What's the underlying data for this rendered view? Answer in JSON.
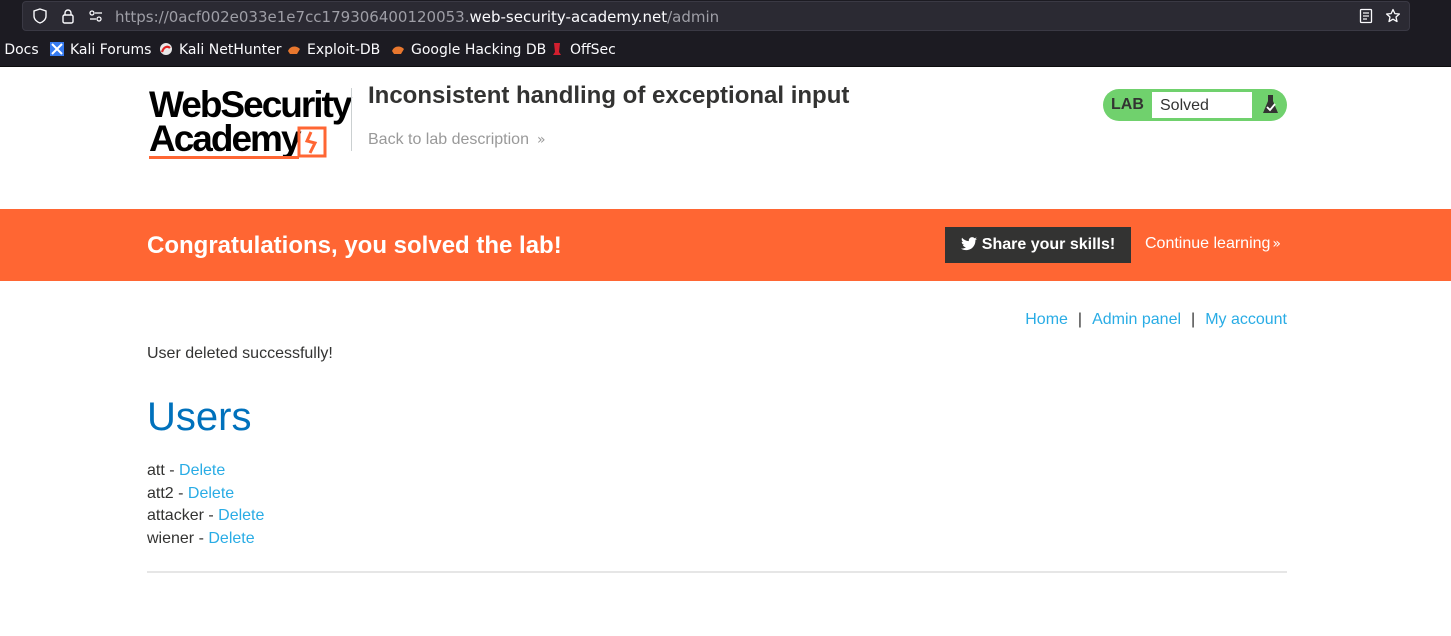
{
  "browser": {
    "url_prefix": "https://0acf002e033e1e7cc179306400120053.",
    "url_domain": "web-security-academy.net",
    "url_path": "/admin",
    "bookmarks": [
      {
        "label": "i Docs",
        "icon": "docs-icon"
      },
      {
        "label": "Kali Forums",
        "icon": "kali-forums-icon"
      },
      {
        "label": "Kali NetHunter",
        "icon": "nethunter-icon"
      },
      {
        "label": "Exploit-DB",
        "icon": "exploit-db-icon"
      },
      {
        "label": "Google Hacking DB",
        "icon": "ghdb-icon"
      },
      {
        "label": "OffSec",
        "icon": "offsec-icon"
      }
    ]
  },
  "header": {
    "logo_line1": "WebSecurity",
    "logo_line2": "Academy",
    "title": "Inconsistent handling of exceptional input",
    "back_link": "Back to lab description",
    "lab_label": "LAB",
    "lab_status": "Solved"
  },
  "banner": {
    "text": "Congratulations, you solved the lab!",
    "share_label": "Share your skills!",
    "continue_label": "Continue learning"
  },
  "nav": {
    "home": "Home",
    "admin": "Admin panel",
    "account": "My account",
    "separator": "|"
  },
  "main": {
    "notice": "User deleted successfully!",
    "heading": "Users",
    "users": [
      {
        "name": "att",
        "action": "Delete"
      },
      {
        "name": "att2",
        "action": "Delete"
      },
      {
        "name": "attacker",
        "action": "Delete"
      },
      {
        "name": "wiener",
        "action": "Delete"
      }
    ]
  },
  "colors": {
    "banner": "#ff6633",
    "link": "#29ace5",
    "heading": "#0071bc",
    "lab_badge": "#70d16d"
  }
}
